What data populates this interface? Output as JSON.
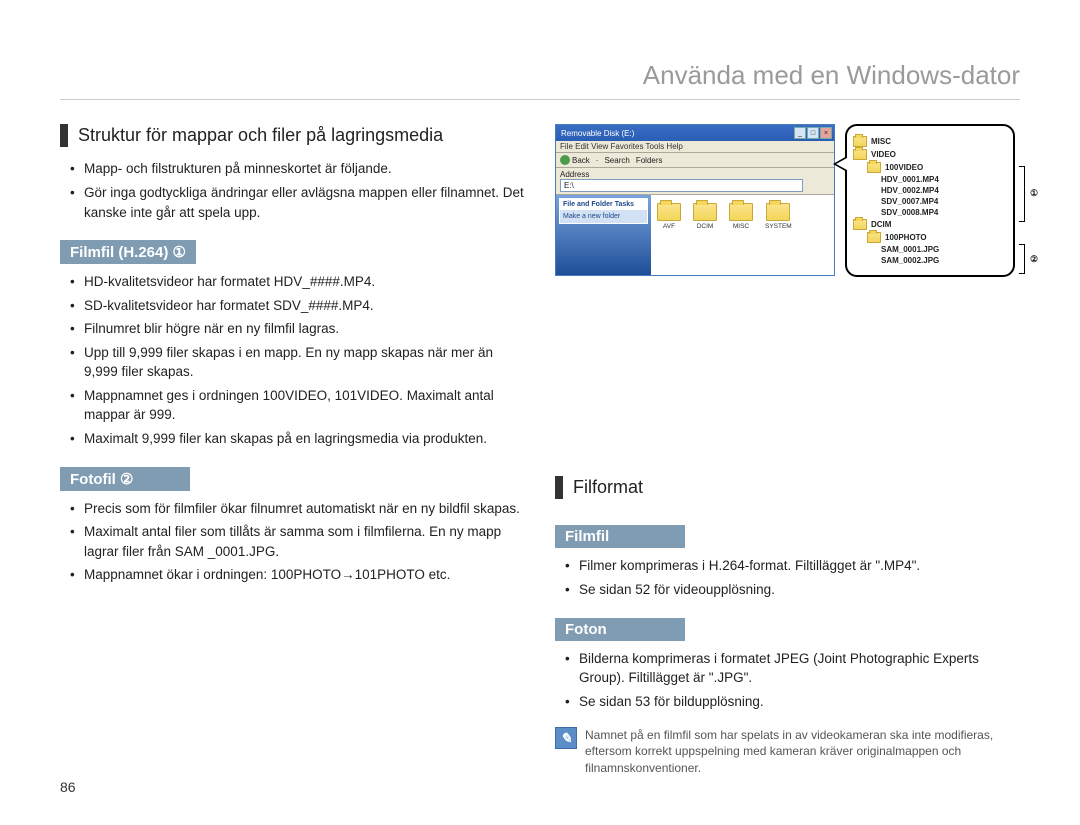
{
  "page_title": "Använda med en Windows-dator",
  "page_number": "86",
  "left": {
    "heading": "Struktur för mappar och filer på lagringsmedia",
    "intro": [
      "Mapp- och filstrukturen på minneskortet är följande.",
      "Gör inga godtyckliga ändringar eller avlägsna mappen eller filnamnet. Det kanske inte går att spela upp."
    ],
    "sub1_title": "Filmfil (H.264) ①",
    "sub1_items": [
      "HD-kvalitetsvideor har formatet HDV_####.MP4.",
      "SD-kvalitetsvideor har formatet SDV_####.MP4.",
      "Filnumret blir högre när en ny filmfil lagras.",
      "Upp till 9,999 filer skapas i en mapp. En ny mapp skapas när mer än 9,999 filer skapas.",
      "Mappnamnet ges i ordningen 100VIDEO, 101VIDEO. Maximalt antal mappar är 999.",
      "Maximalt 9,999 filer kan skapas på en lagringsmedia via produkten."
    ],
    "sub2_title": "Fotofil ②",
    "sub2_items": [
      "Precis som för filmfiler ökar filnumret automatiskt när en ny bildfil skapas.",
      "Maximalt antal filer som tillåts är samma som i filmfilerna. En ny mapp lagrar filer från SAM _0001.JPG.",
      "Mappnamnet ökar i ordningen: 100PHOTO→101PHOTO etc."
    ]
  },
  "right": {
    "heading": "Filformat",
    "sub1_title": "Filmfil",
    "sub1_items": [
      "Filmer komprimeras i H.264-format. Filtillägget är \".MP4\".",
      "Se sidan 52 för videoupplösning."
    ],
    "sub2_title": "Foton",
    "sub2_items": [
      "Bilderna komprimeras i formatet JPEG (Joint Photographic Experts Group). Filtillägget är \".JPG\".",
      "Se sidan 53 för bildupplösning."
    ],
    "note": "Namnet på en filmfil som har spelats in av videokameran ska inte modifieras, eftersom korrekt uppspelning med kameran kräver originalmappen och filnamnskonventioner."
  },
  "screenshot": {
    "window_title": "Removable Disk (E:)",
    "menu": "File  Edit  View  Favorites  Tools  Help",
    "back": "Back",
    "search": "Search",
    "folders_btn": "Folders",
    "address_label": "Address",
    "address_value": "E:\\",
    "side_title": "File and Folder Tasks",
    "side_item": "Make a new folder",
    "folders": [
      "AVF",
      "DCIM",
      "MISC",
      "SYSTEM"
    ]
  },
  "tree": {
    "misc": "MISC",
    "video": "VIDEO",
    "video_sub": "100VIDEO",
    "video_files": [
      "HDV_0001.MP4",
      "HDV_0002.MP4",
      "SDV_0007.MP4",
      "SDV_0008.MP4"
    ],
    "dcim": "DCIM",
    "dcim_sub": "100PHOTO",
    "dcim_files": [
      "SAM_0001.JPG",
      "SAM_0002.JPG"
    ],
    "marker1": "①",
    "marker2": "②"
  }
}
